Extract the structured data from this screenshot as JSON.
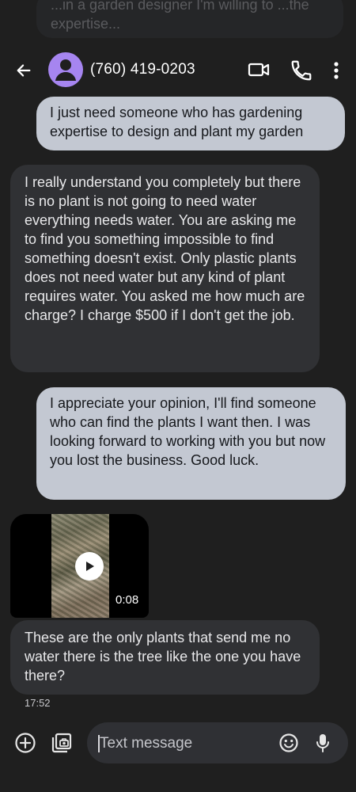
{
  "ghost": {
    "text": "...in a garden designer I'm willing to ...the expertise..."
  },
  "header": {
    "contact_name": "(760) 419-0203",
    "avatar_color": "#a685f0"
  },
  "messages": {
    "m1": "I just need someone who has gardening expertise to design and plant my garden",
    "m2": "I really understand you completely but there is no plant is not going to need water everything needs water. You are asking me to find you something impossible to find something doesn't exist. Only plastic plants does not need water but any kind of plant requires water. You asked me how much are charge? I charge $500 if I don't get the job.",
    "m3": "I appreciate your opinion, I'll find someone who can find the plants I want then. I was looking forward to working with you but now you lost the business. Good luck.",
    "video_duration": "0:08",
    "m4": "These are the only plants that send me no water there is the tree like the one you have there?",
    "timestamp": "17:52"
  },
  "composer": {
    "placeholder": "Text message"
  },
  "colors": {
    "background": "#1f1f1f",
    "outgoing_bubble": "#c3c8d2",
    "incoming_bubble": "#303134"
  }
}
